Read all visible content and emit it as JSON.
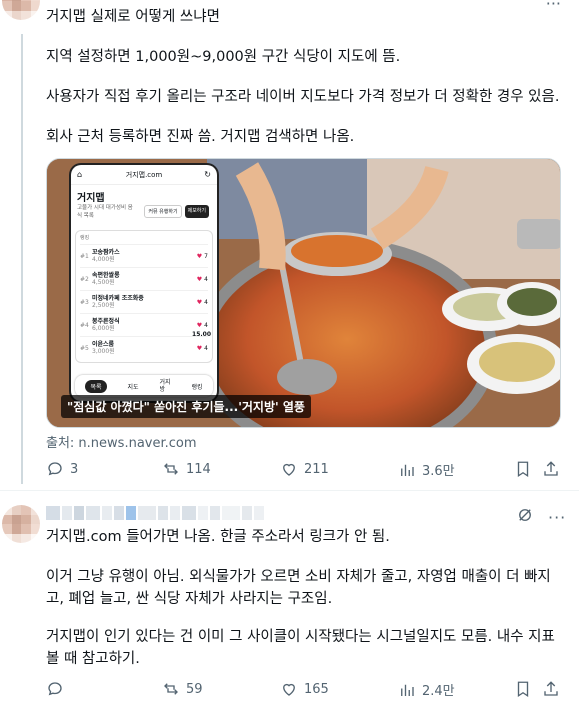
{
  "tweet1": {
    "lines": [
      "거지맵 실제로 어떻게 쓰냐면",
      "지역 설정하면 1,000원~9,000원 구간 식당이 지도에 뜸.",
      "사용자가 직접 후기 올리는 구조라 네이버 지도보다 가격 정보가 더 정확한 경우 있음.",
      "회사 근처 등록하면 진짜 씀. 거지맵 검색하면 나옴."
    ],
    "media_caption": "\"점심값 아꼈다\" 쏟아진 후기들...'거지방' 열풍",
    "phone": {
      "url": "거지맵.com",
      "title": "거지맵",
      "subtitle": "고물가 시대 대가성비 음식 목록",
      "btn_secondary": "커뮤 유행하기",
      "btn_primary": "제보하기",
      "list": [
        {
          "rank": "#1",
          "name": "꼬송짬카스",
          "price": "4,000원",
          "score": "7"
        },
        {
          "rank": "#2",
          "name": "속편한쌀롱",
          "price": "4,500원",
          "score": "4"
        },
        {
          "rank": "#3",
          "name": "미정네카페 조조화중",
          "price": "2,500원",
          "score": "4"
        },
        {
          "rank": "#4",
          "name": "봉주른정식",
          "price": "6,000원",
          "score": "4"
        },
        {
          "rank": "#5",
          "name": "이윤스룸",
          "price": "3,000원",
          "score": "4"
        }
      ],
      "map_label": "15.00",
      "tab_list": "목록",
      "tab_map": "지도",
      "tab_combined": "거지\n방",
      "tab_ranking": "랭킹"
    },
    "source": "출처: n.news.naver.com",
    "actions": {
      "replies": "3",
      "retweets": "114",
      "likes": "211",
      "views": "3.6만"
    }
  },
  "tweet2": {
    "lines": [
      "거지맵.com 들어가면 나옴. 한글 주소라서 링크가 안 됨.",
      "이거 그냥 유행이 아님. 외식물가가 오르면 소비 자체가 줄고, 자영업 매출이 더 빠지고, 폐업 늘고, 싼 식당 자체가 사라지는 구조임.",
      "거지맵이 인기 있다는 건 이미 그 사이클이 시작됐다는 시그널일지도 모름. 내수 지표 볼 때 참고하기."
    ],
    "actions": {
      "replies": "",
      "retweets": "59",
      "likes": "165",
      "views": "2.4만"
    }
  },
  "icons": {
    "reply": "reply-icon",
    "retweet": "retweet-icon",
    "like": "heart-icon",
    "views": "views-icon",
    "bookmark": "bookmark-icon",
    "share": "share-icon",
    "grok": "grok-icon",
    "more": "more-icon"
  },
  "colors": {
    "text": "#0f1419",
    "muted": "#536471",
    "border": "#cfd9de"
  }
}
